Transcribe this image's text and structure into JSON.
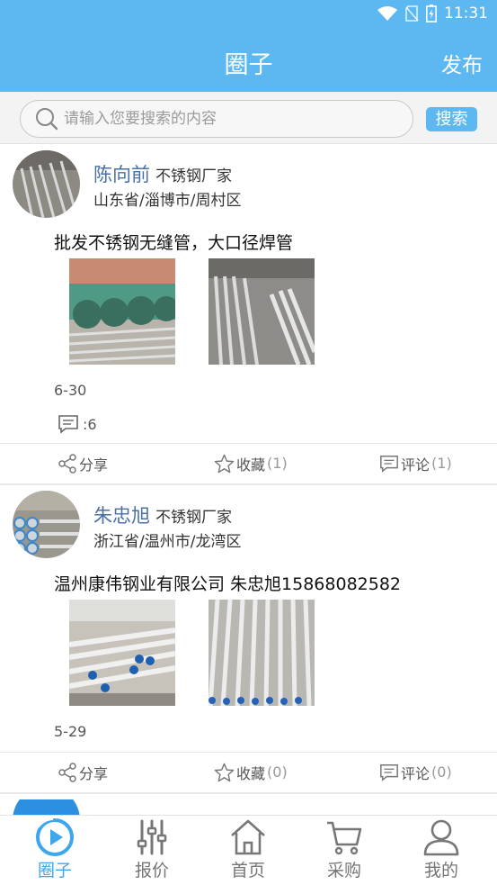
{
  "status_bar": {
    "time": "11:31"
  },
  "header": {
    "title": "圈子",
    "publish_label": "发布"
  },
  "search": {
    "placeholder": "请输入您要搜索的内容",
    "button_label": "搜索"
  },
  "posts": [
    {
      "name": "陈向前",
      "tag": "不锈钢厂家",
      "location": "山东省/淄博市/周村区",
      "content": "批发不锈钢无缝管，大口径焊管",
      "date": "6-30",
      "comment_count_label": ":6",
      "share_label": "分享",
      "fav_label": "收藏",
      "fav_count": "(1)",
      "comment_label": "评论",
      "comment_count": "(1)"
    },
    {
      "name": "朱忠旭",
      "tag": "不锈钢厂家",
      "location": "浙江省/温州市/龙湾区",
      "content": "温州康伟钢业有限公司 朱忠旭15868082582",
      "date": "5-29",
      "share_label": "分享",
      "fav_label": "收藏",
      "fav_count": "(0)",
      "comment_label": "评论",
      "comment_count": "(0)"
    }
  ],
  "tabs": [
    {
      "label": "圈子",
      "icon": "circle-play-icon",
      "active": true
    },
    {
      "label": "报价",
      "icon": "sliders-icon",
      "active": false
    },
    {
      "label": "首页",
      "icon": "home-icon",
      "active": false
    },
    {
      "label": "采购",
      "icon": "cart-icon",
      "active": false
    },
    {
      "label": "我的",
      "icon": "user-icon",
      "active": false
    }
  ],
  "colors": {
    "primary": "#5db8f2",
    "name": "#4b70a8",
    "active_tab": "#3ea6ee"
  }
}
